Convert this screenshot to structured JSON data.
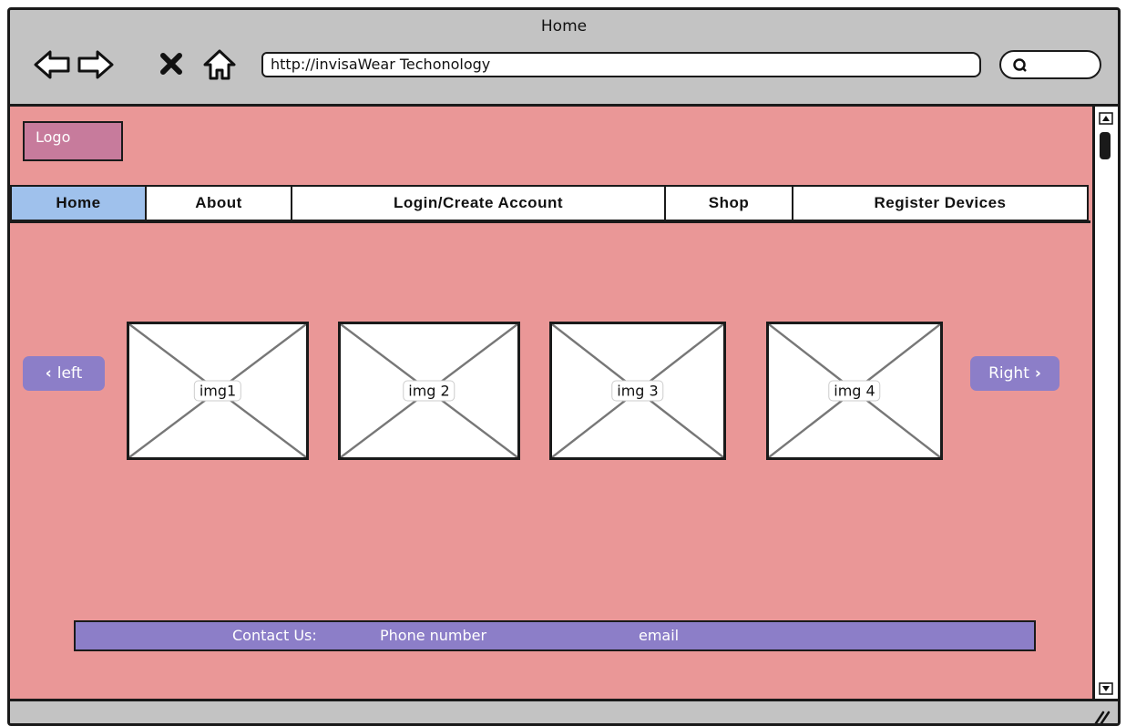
{
  "window": {
    "title": "Home",
    "url": "http://invisaWear Techonology",
    "icons": [
      "back-arrow-icon",
      "forward-arrow-icon",
      "close-icon",
      "home-icon",
      "search-icon"
    ]
  },
  "logo": {
    "label": "Logo"
  },
  "nav": {
    "items": [
      {
        "label": "Home",
        "active": true
      },
      {
        "label": "About"
      },
      {
        "label": "Login/Create Account"
      },
      {
        "label": "Shop"
      },
      {
        "label": "Register Devices"
      }
    ]
  },
  "carousel": {
    "left_label": "left",
    "right_label": "Right",
    "images": [
      "img1",
      "img 2",
      "img 3",
      "img 4"
    ]
  },
  "footer": {
    "contact_label": "Contact Us:",
    "phone_label": "Phone number",
    "email_label": "email"
  },
  "colors": {
    "page_background": "#ea9797",
    "logo": "#c77b9c",
    "active_tab": "#9fc1ec",
    "accent": "#8c7ec8",
    "chrome": "#c3c3c3"
  }
}
